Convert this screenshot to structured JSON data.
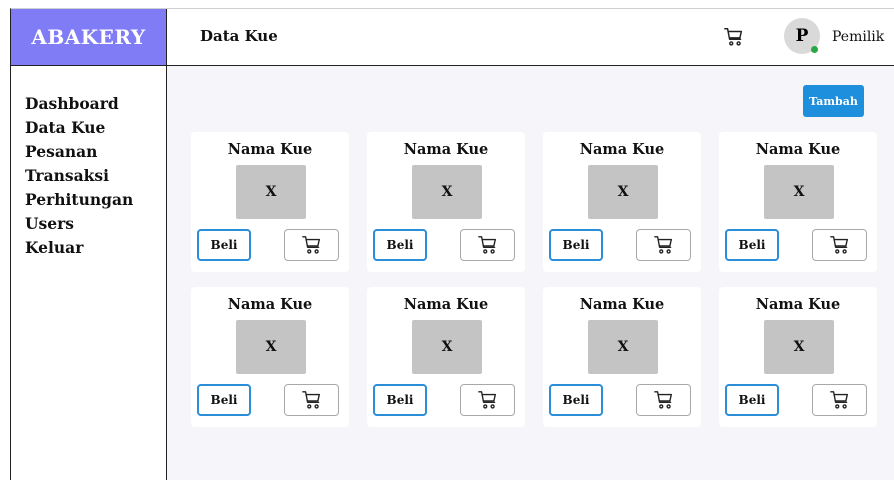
{
  "brand": {
    "name": "ABAKERY",
    "color": "#7f7cf6"
  },
  "header": {
    "title": "Data Kue",
    "cart_icon": "cart-icon"
  },
  "user": {
    "initial": "P",
    "name": "Pemilik",
    "status_color": "#29a745"
  },
  "sidebar": {
    "items": [
      {
        "label": "Dashboard"
      },
      {
        "label": "Data Kue"
      },
      {
        "label": "Pesanan"
      },
      {
        "label": "Transaksi"
      },
      {
        "label": "Perhitungan"
      },
      {
        "label": "Users"
      },
      {
        "label": "Keluar"
      }
    ]
  },
  "toolbar": {
    "add_label": "Tambah",
    "accent": "#1e8fdc"
  },
  "products": [
    {
      "name": "Nama Kue",
      "image_placeholder": "X",
      "buy_label": "Beli"
    },
    {
      "name": "Nama Kue",
      "image_placeholder": "X",
      "buy_label": "Beli"
    },
    {
      "name": "Nama Kue",
      "image_placeholder": "X",
      "buy_label": "Beli"
    },
    {
      "name": "Nama Kue",
      "image_placeholder": "X",
      "buy_label": "Beli"
    },
    {
      "name": "Nama Kue",
      "image_placeholder": "X",
      "buy_label": "Beli"
    },
    {
      "name": "Nama Kue",
      "image_placeholder": "X",
      "buy_label": "Beli"
    },
    {
      "name": "Nama Kue",
      "image_placeholder": "X",
      "buy_label": "Beli"
    },
    {
      "name": "Nama Kue",
      "image_placeholder": "X",
      "buy_label": "Beli"
    }
  ]
}
